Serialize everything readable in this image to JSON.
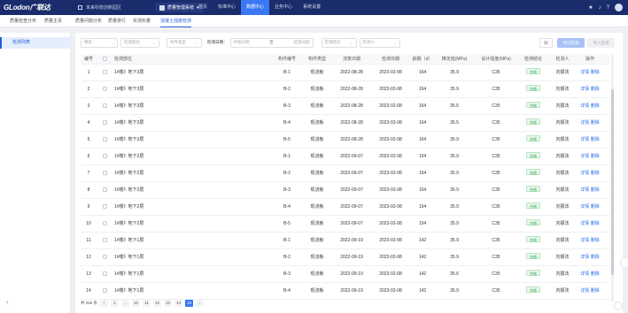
{
  "topbar": {
    "logo": "GLodon广联达",
    "project": "未来科技创新园区",
    "system": "质量管理系统",
    "system_caret": "▾",
    "nav": [
      "首页",
      "标准中心",
      "数据中心",
      "业务中心",
      "系统设置"
    ],
    "active_nav": 2,
    "icons": [
      "star-icon",
      "bell-icon",
      "help-icon"
    ]
  },
  "subnav": {
    "tabs": [
      "质量检查分布",
      "质量主责",
      "质量问题分析",
      "质量排行",
      "实测实量",
      "混凝土强度检测"
    ],
    "active": 5
  },
  "sidebar": {
    "active_item": "检测列表",
    "collapse_glyph": "‹"
  },
  "filters": {
    "building_ph": "楼栋",
    "floor_ph": "检测部位",
    "component_ph": "构件类型",
    "date_label": "检测日期：",
    "start_ph": "开始日期",
    "end_ph": "结束日期",
    "result_ph": "检测结论",
    "person_ph": "检测人",
    "caret": "⌄",
    "sep": "至",
    "buttons": {
      "delete": "删",
      "export": "导出检测",
      "import": "导入检测"
    }
  },
  "table": {
    "headers": [
      "编号",
      "",
      "检测部位",
      "构件编号",
      "构件类型",
      "浇筑日期",
      "检测日期",
      "龄期（d）",
      "推定值(MPa)",
      "设计强度(MPa)",
      "检测结论",
      "检测人",
      "操作"
    ],
    "rows": [
      [
        "1",
        "1#楼》地下3层",
        "B-1",
        "现浇板",
        "2022-08-28",
        "2023-02-08",
        "164",
        "35.9",
        "C35",
        "合格",
        "刘振法"
      ],
      [
        "2",
        "1#楼》地下3层",
        "B-2",
        "现浇板",
        "2022-08-28",
        "2023-02-08",
        "164",
        "35.9",
        "C35",
        "合格",
        "刘振法"
      ],
      [
        "3",
        "1#楼》地下3层",
        "B-3",
        "现浇板",
        "2022-08-28",
        "2023-02-08",
        "164",
        "35.5",
        "C35",
        "合格",
        "刘振法"
      ],
      [
        "4",
        "1#楼》地下3层",
        "B-4",
        "现浇板",
        "2022-08-28",
        "2023-02-08",
        "164",
        "35.5",
        "C35",
        "合格",
        "刘振法"
      ],
      [
        "5",
        "1#楼》地下3层",
        "B-5",
        "现浇板",
        "2022-08-28",
        "2023-02-08",
        "164",
        "35.9",
        "C35",
        "合格",
        "刘振法"
      ],
      [
        "6",
        "1#楼》地下2层",
        "B-1",
        "现浇板",
        "2022-09-07",
        "2023-02-08",
        "154",
        "35.9",
        "C35",
        "合格",
        "刘振法"
      ],
      [
        "7",
        "1#楼》地下2层",
        "B-2",
        "现浇板",
        "2022-09-07",
        "2023-02-08",
        "154",
        "35.9",
        "C35",
        "合格",
        "刘振法"
      ],
      [
        "8",
        "1#楼》地下2层",
        "B-3",
        "现浇板",
        "2022-09-07",
        "2023-02-08",
        "154",
        "35.9",
        "C35",
        "合格",
        "刘振法"
      ],
      [
        "9",
        "1#楼》地下2层",
        "B-4",
        "现浇板",
        "2022-09-07",
        "2023-02-08",
        "154",
        "35.9",
        "C35",
        "合格",
        "刘振法"
      ],
      [
        "10",
        "1#楼》地下2层",
        "B-5",
        "现浇板",
        "2022-09-07",
        "2023-02-08",
        "154",
        "35.9",
        "C35",
        "合格",
        "刘振法"
      ],
      [
        "11",
        "1#楼》地下1层",
        "B-1",
        "现浇板",
        "2022-09-19",
        "2023-02-08",
        "142",
        "35.9",
        "C35",
        "合格",
        "刘振法"
      ],
      [
        "12",
        "1#楼》地下1层",
        "B-2",
        "现浇板",
        "2022-09-19",
        "2023-02-08",
        "142",
        "35.9",
        "C35",
        "合格",
        "刘振法"
      ],
      [
        "13",
        "1#楼》地下1层",
        "B-3",
        "现浇板",
        "2022-09-19",
        "2023-02-08",
        "142",
        "35.6",
        "C35",
        "合格",
        "刘振法"
      ],
      [
        "14",
        "1#楼》地下1层",
        "B-4",
        "现浇板",
        "2022-09-19",
        "2023-02-08",
        "142",
        "35.9",
        "C35",
        "合格",
        "刘振法"
      ]
    ],
    "actions": [
      "详情",
      "删除"
    ]
  },
  "pager": {
    "total": "共 265 条",
    "prev": "‹",
    "next": "›",
    "pages": [
      "1",
      "...",
      "10",
      "11",
      "12",
      "13",
      "14",
      "15"
    ],
    "active": "15"
  },
  "colors": {
    "topbar": "#1a2c6b",
    "accent": "#3a79f5",
    "pass_tag": "#3aa55a"
  }
}
